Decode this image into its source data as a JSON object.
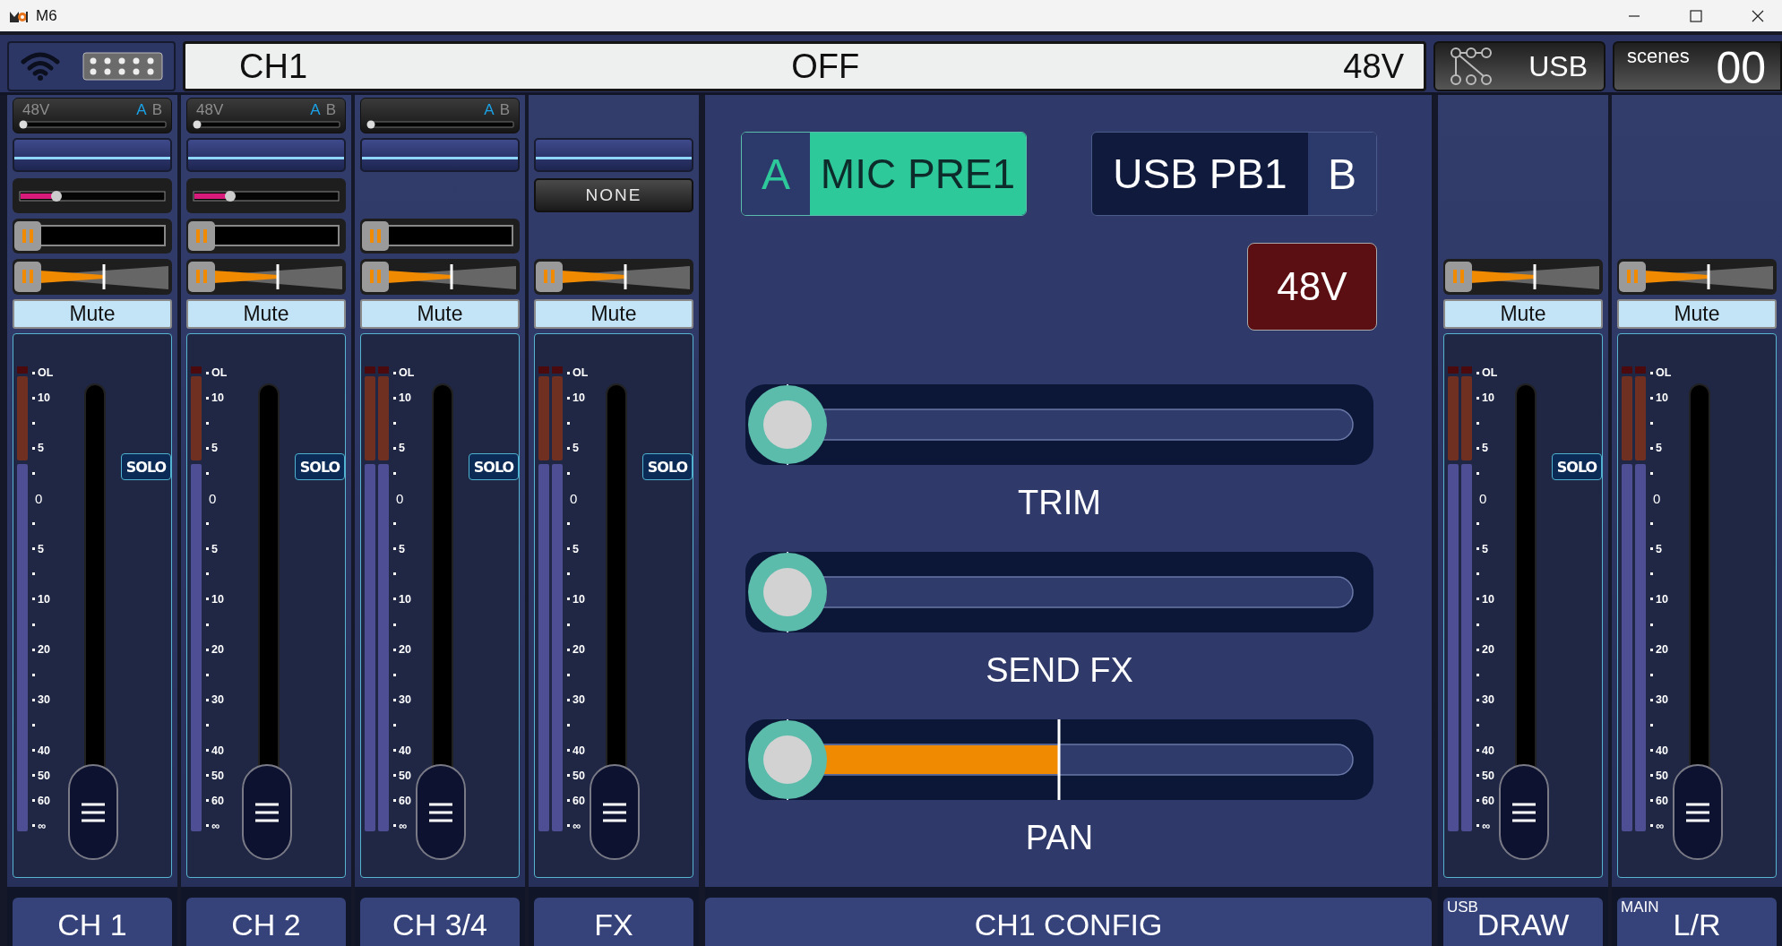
{
  "window": {
    "title": "M6"
  },
  "header": {
    "display": {
      "channel": "CH1",
      "status": "OFF",
      "phantom": "48V"
    },
    "routing": {
      "label": "USB"
    },
    "scenes": {
      "label": "scenes",
      "number": "00"
    }
  },
  "input_strips": [
    {
      "name": "CH 1",
      "input": {
        "phantom": "48V",
        "sources": [
          {
            "label": "A",
            "selected": true
          },
          {
            "label": "B",
            "selected": false
          }
        ],
        "level": 0
      },
      "eq": true,
      "gain": {
        "level": 0.25
      },
      "gate": true,
      "pan": {
        "level": 0.5
      },
      "mute": {
        "label": "Mute",
        "on": false
      },
      "solo": {
        "label": "SOLO",
        "on": false
      },
      "meter": {
        "stereo": false
      },
      "fader": {
        "level": 0
      },
      "scale": [
        {
          "kind": "tick",
          "label": "OL"
        },
        {
          "kind": "tick",
          "label": "10"
        },
        {
          "kind": "dot"
        },
        {
          "kind": "tick",
          "label": "5"
        },
        {
          "kind": "dot"
        },
        {
          "kind": "plain",
          "label": "0"
        },
        {
          "kind": "dot"
        },
        {
          "kind": "tick",
          "label": "5"
        },
        {
          "kind": "dot"
        },
        {
          "kind": "tick",
          "label": "10"
        },
        {
          "kind": "dot"
        },
        {
          "kind": "tick",
          "label": "20"
        },
        {
          "kind": "dot"
        },
        {
          "kind": "tick",
          "label": "30"
        },
        {
          "kind": "dot"
        },
        {
          "kind": "tick",
          "label": "40"
        },
        {
          "kind": "tick",
          "label": "50"
        },
        {
          "kind": "tick",
          "label": "60"
        },
        {
          "kind": "tick",
          "label": "∞"
        }
      ]
    },
    {
      "name": "CH 2",
      "input": {
        "phantom": "48V",
        "sources": [
          {
            "label": "A",
            "selected": true
          },
          {
            "label": "B",
            "selected": false
          }
        ],
        "level": 0
      },
      "eq": true,
      "gain": {
        "level": 0.25
      },
      "gate": true,
      "pan": {
        "level": 0.5
      },
      "mute": {
        "label": "Mute",
        "on": false
      },
      "solo": {
        "label": "SOLO",
        "on": false
      },
      "meter": {
        "stereo": false
      },
      "fader": {
        "level": 0
      },
      "scale": [
        {
          "kind": "tick",
          "label": "OL"
        },
        {
          "kind": "tick",
          "label": "10"
        },
        {
          "kind": "dot"
        },
        {
          "kind": "tick",
          "label": "5"
        },
        {
          "kind": "dot"
        },
        {
          "kind": "plain",
          "label": "0"
        },
        {
          "kind": "dot"
        },
        {
          "kind": "tick",
          "label": "5"
        },
        {
          "kind": "dot"
        },
        {
          "kind": "tick",
          "label": "10"
        },
        {
          "kind": "dot"
        },
        {
          "kind": "tick",
          "label": "20"
        },
        {
          "kind": "dot"
        },
        {
          "kind": "tick",
          "label": "30"
        },
        {
          "kind": "dot"
        },
        {
          "kind": "tick",
          "label": "40"
        },
        {
          "kind": "tick",
          "label": "50"
        },
        {
          "kind": "tick",
          "label": "60"
        },
        {
          "kind": "tick",
          "label": "∞"
        }
      ]
    },
    {
      "name": "CH 3/4",
      "input": {
        "sources": [
          {
            "label": "A",
            "selected": true
          },
          {
            "label": "B",
            "selected": false
          }
        ],
        "level": 0
      },
      "eq": true,
      "gate": true,
      "pan": {
        "level": 0.5
      },
      "mute": {
        "label": "Mute",
        "on": false
      },
      "solo": {
        "label": "SOLO",
        "on": false
      },
      "meter": {
        "stereo": true
      },
      "fader": {
        "level": 0
      },
      "scale": [
        {
          "kind": "tick",
          "label": "OL"
        },
        {
          "kind": "tick",
          "label": "10"
        },
        {
          "kind": "dot"
        },
        {
          "kind": "tick",
          "label": "5"
        },
        {
          "kind": "dot"
        },
        {
          "kind": "plain",
          "label": "0"
        },
        {
          "kind": "dot"
        },
        {
          "kind": "tick",
          "label": "5"
        },
        {
          "kind": "dot"
        },
        {
          "kind": "tick",
          "label": "10"
        },
        {
          "kind": "dot"
        },
        {
          "kind": "tick",
          "label": "20"
        },
        {
          "kind": "dot"
        },
        {
          "kind": "tick",
          "label": "30"
        },
        {
          "kind": "dot"
        },
        {
          "kind": "tick",
          "label": "40"
        },
        {
          "kind": "tick",
          "label": "50"
        },
        {
          "kind": "tick",
          "label": "60"
        },
        {
          "kind": "tick",
          "label": "∞"
        }
      ]
    },
    {
      "name": "FX",
      "eq": true,
      "fx_select": "NONE",
      "pan": {
        "level": 0.5
      },
      "mute": {
        "label": "Mute",
        "on": false
      },
      "solo": {
        "label": "SOLO",
        "on": false
      },
      "meter": {
        "stereo": true
      },
      "fader": {
        "level": 0
      },
      "scale": [
        {
          "kind": "tick",
          "label": "OL"
        },
        {
          "kind": "tick",
          "label": "10"
        },
        {
          "kind": "dot"
        },
        {
          "kind": "tick",
          "label": "5"
        },
        {
          "kind": "dot"
        },
        {
          "kind": "plain",
          "label": "0"
        },
        {
          "kind": "dot"
        },
        {
          "kind": "tick",
          "label": "5"
        },
        {
          "kind": "dot"
        },
        {
          "kind": "tick",
          "label": "10"
        },
        {
          "kind": "dot"
        },
        {
          "kind": "tick",
          "label": "20"
        },
        {
          "kind": "dot"
        },
        {
          "kind": "tick",
          "label": "30"
        },
        {
          "kind": "dot"
        },
        {
          "kind": "tick",
          "label": "40"
        },
        {
          "kind": "tick",
          "label": "50"
        },
        {
          "kind": "tick",
          "label": "60"
        },
        {
          "kind": "tick",
          "label": "∞"
        }
      ]
    }
  ],
  "config": {
    "title": "CH1 CONFIG",
    "sources": [
      {
        "letter": "A",
        "label": "MIC PRE1",
        "selected": true
      },
      {
        "letter": "B",
        "label": "USB PB1",
        "selected": false
      }
    ],
    "phantom": {
      "label": "48V",
      "on": true
    },
    "sliders": [
      {
        "kind": "plain",
        "label": "TRIM",
        "level": 0
      },
      {
        "kind": "plain",
        "label": "SEND FX",
        "level": 0
      },
      {
        "kind": "pan",
        "label": "PAN",
        "level": 0
      }
    ]
  },
  "output_strips": [
    {
      "prefix": "USB",
      "name": "DRAW",
      "pan": {
        "level": 0.5
      },
      "mute": {
        "label": "Mute",
        "on": false
      },
      "solo": {
        "label": "SOLO",
        "on": false
      },
      "meter": {
        "stereo": true
      },
      "fader": {
        "level": 0
      },
      "scale": [
        {
          "kind": "tick",
          "label": "OL"
        },
        {
          "kind": "tick",
          "label": "10"
        },
        {
          "kind": "dot"
        },
        {
          "kind": "tick",
          "label": "5"
        },
        {
          "kind": "dot"
        },
        {
          "kind": "plain",
          "label": "0"
        },
        {
          "kind": "dot"
        },
        {
          "kind": "tick",
          "label": "5"
        },
        {
          "kind": "dot"
        },
        {
          "kind": "tick",
          "label": "10"
        },
        {
          "kind": "dot"
        },
        {
          "kind": "tick",
          "label": "20"
        },
        {
          "kind": "dot"
        },
        {
          "kind": "tick",
          "label": "30"
        },
        {
          "kind": "dot"
        },
        {
          "kind": "tick",
          "label": "40"
        },
        {
          "kind": "tick",
          "label": "50"
        },
        {
          "kind": "tick",
          "label": "60"
        },
        {
          "kind": "tick",
          "label": "∞"
        }
      ]
    },
    {
      "prefix": "MAIN",
      "name": "L/R",
      "pan": {
        "level": 0.5
      },
      "mute": {
        "label": "Mute",
        "on": false
      },
      "meter": {
        "stereo": true
      },
      "fader": {
        "level": 0
      },
      "scale": [
        {
          "kind": "tick",
          "label": "OL"
        },
        {
          "kind": "tick",
          "label": "10"
        },
        {
          "kind": "dot"
        },
        {
          "kind": "tick",
          "label": "5"
        },
        {
          "kind": "dot"
        },
        {
          "kind": "plain",
          "label": "0"
        },
        {
          "kind": "dot"
        },
        {
          "kind": "tick",
          "label": "5"
        },
        {
          "kind": "dot"
        },
        {
          "kind": "tick",
          "label": "10"
        },
        {
          "kind": "dot"
        },
        {
          "kind": "tick",
          "label": "20"
        },
        {
          "kind": "dot"
        },
        {
          "kind": "tick",
          "label": "30"
        },
        {
          "kind": "dot"
        },
        {
          "kind": "tick",
          "label": "40"
        },
        {
          "kind": "tick",
          "label": "50"
        },
        {
          "kind": "tick",
          "label": "60"
        },
        {
          "kind": "tick",
          "label": "∞"
        }
      ]
    }
  ]
}
